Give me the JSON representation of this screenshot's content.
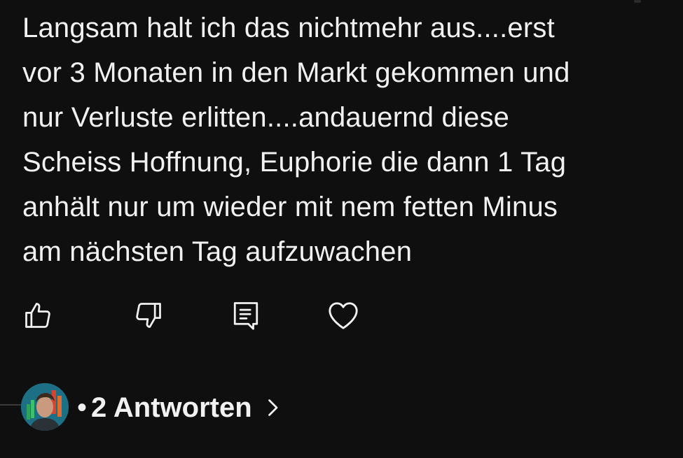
{
  "comment": {
    "text": "Langsam halt ich das nichtmehr aus....erst\nvor 3 Monaten in den Markt gekommen und\nnur Verluste erlitten....andauernd diese\nScheiss Hoffnung, Euphorie die dann 1 Tag\nanhält nur um wieder mit nem fetten Minus\nam nächsten Tag aufzuwachen"
  },
  "actions": [
    {
      "name": "like",
      "icon": "thumbs-up-icon"
    },
    {
      "name": "dislike",
      "icon": "thumbs-down-icon"
    },
    {
      "name": "reply",
      "icon": "comment-icon"
    },
    {
      "name": "heart",
      "icon": "heart-icon"
    }
  ],
  "replies": {
    "separator": "•",
    "label": "2 Antworten",
    "chevron_icon": "chevron-right-icon"
  },
  "colors": {
    "background": "#0f0f0f",
    "text": "#f1f1f1"
  }
}
